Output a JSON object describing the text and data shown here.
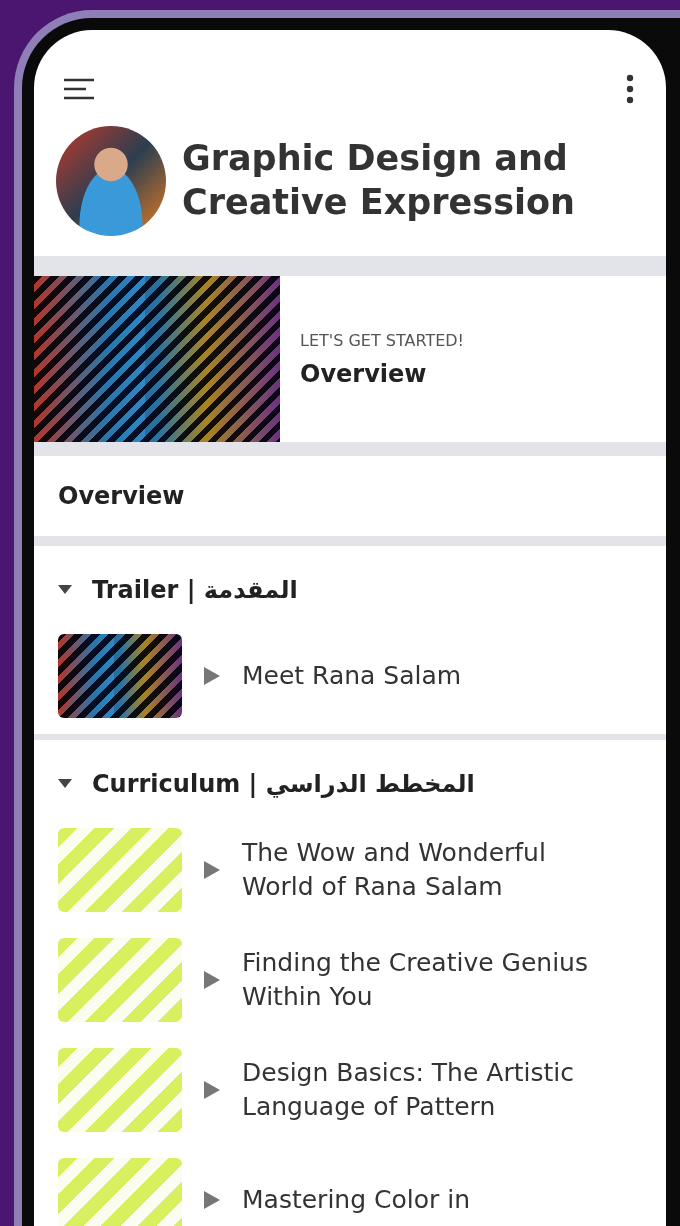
{
  "course": {
    "title": "Graphic Design and Creative Expression"
  },
  "featured": {
    "eyebrow": "LET'S GET STARTED!",
    "title": "Overview"
  },
  "overview_row": {
    "label": "Overview"
  },
  "sections": [
    {
      "title": "Trailer | المقدمة",
      "expanded": true,
      "lessons": [
        {
          "title": "Meet Rana Salam",
          "kind": "photo"
        }
      ]
    },
    {
      "title": "Curriculum | المخطط الدراسي",
      "expanded": true,
      "lessons": [
        {
          "title": "The Wow and Wonderful World of Rana Salam",
          "kind": "stripes"
        },
        {
          "title": "Finding the Creative Genius Within You",
          "kind": "stripes"
        },
        {
          "title": "Design Basics: The Artistic Language of Pattern",
          "kind": "stripes"
        },
        {
          "title": "Mastering Color in",
          "kind": "stripes"
        }
      ]
    }
  ]
}
